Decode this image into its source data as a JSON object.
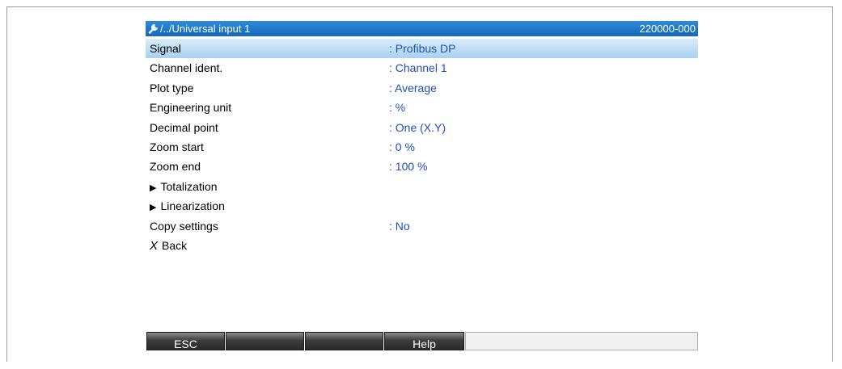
{
  "title": {
    "path": "/../Universal input 1",
    "code": "220000-000"
  },
  "items": [
    {
      "label": "Signal",
      "value": ": Profibus DP",
      "kind": "param",
      "selected": true
    },
    {
      "label": "Channel ident.",
      "value": ": Channel 1",
      "kind": "param"
    },
    {
      "label": "Plot type",
      "value": ": Average",
      "kind": "param"
    },
    {
      "label": "Engineering unit",
      "value": ": %",
      "kind": "param"
    },
    {
      "label": "Decimal point",
      "value": ": One (X.Y)",
      "kind": "param"
    },
    {
      "label": "Zoom start",
      "value": ": 0 %",
      "kind": "param"
    },
    {
      "label": "Zoom end",
      "value": ": 100 %",
      "kind": "param"
    },
    {
      "label": "Totalization",
      "value": "",
      "kind": "submenu"
    },
    {
      "label": "Linearization",
      "value": "",
      "kind": "submenu"
    },
    {
      "label": "Copy settings",
      "value": ": No",
      "kind": "param"
    },
    {
      "label": "Back",
      "value": "",
      "kind": "back"
    }
  ],
  "softkeys": [
    "ESC",
    "",
    "",
    "Help",
    ""
  ],
  "colors": {
    "title_bar": "#1b74c9",
    "value_text": "#1f4fb5",
    "selection": "#b9dcf5"
  }
}
